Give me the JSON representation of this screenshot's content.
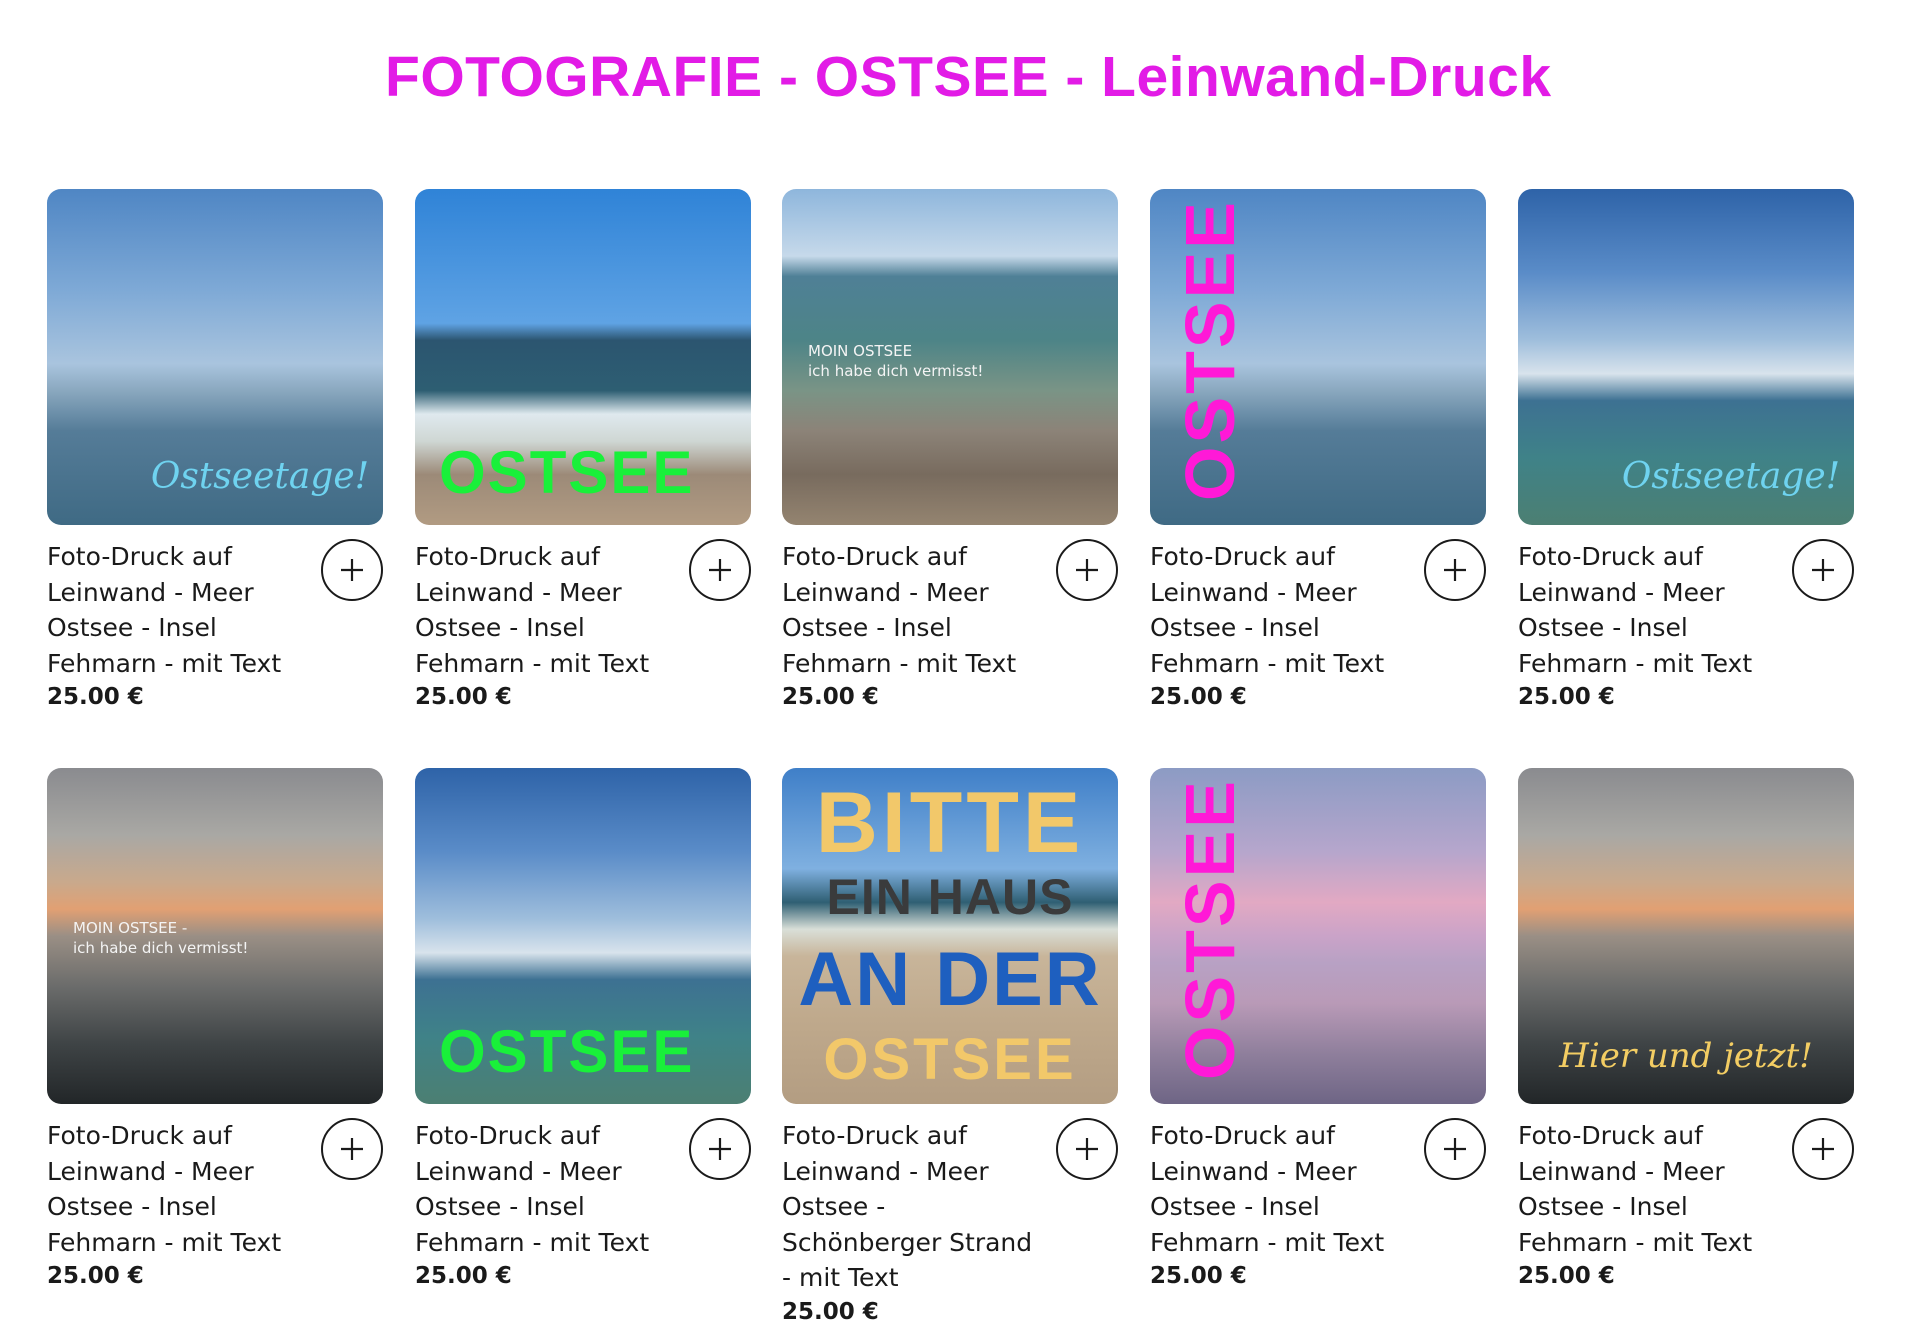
{
  "page": {
    "title": "FOTOGRAFIE - OSTSEE - Leinwand-Druck"
  },
  "colors": {
    "title": "#e21be6",
    "text": "#1a1a1a",
    "overlay_green": "#19f03a",
    "overlay_magenta": "#ff19d7",
    "overlay_cyan": "#6fd3f0",
    "overlay_yellow": "#f3cd63"
  },
  "add_button": {
    "icon": "plus-icon"
  },
  "products": [
    {
      "name": "Foto-Druck auf Leinwand - Meer Ostsee - Insel Fehmarn - mit Text",
      "price": "25.00 €",
      "image": "sea-horizon-blue-sky",
      "overlay_text": "Ostseetage!"
    },
    {
      "name": "Foto-Druck auf Leinwand - Meer Ostsee - Insel Fehmarn - mit Text",
      "price": "25.00 €",
      "image": "breaking-waves-beach",
      "overlay_text": "OSTSEE"
    },
    {
      "name": "Foto-Druck auf Leinwand - Meer Ostsee - Insel Fehmarn - mit Text",
      "price": "25.00 €",
      "image": "pebble-beach-clear-water",
      "overlay_lines": [
        "MOIN OSTSEE",
        "ich habe dich vermisst!"
      ]
    },
    {
      "name": "Foto-Druck auf Leinwand - Meer Ostsee - Insel Fehmarn - mit Text",
      "price": "25.00 €",
      "image": "sea-horizon-blue-sky",
      "overlay_text": "OSTSEE"
    },
    {
      "name": "Foto-Druck auf Leinwand - Meer Ostsee - Insel Fehmarn - mit Text",
      "price": "25.00 €",
      "image": "cloudy-sky-sea",
      "overlay_text": "Ostseetage!"
    },
    {
      "name": "Foto-Druck auf Leinwand - Meer Ostsee - Insel Fehmarn - mit Text",
      "price": "25.00 €",
      "image": "sunset-sea",
      "overlay_lines": [
        "MOIN OSTSEE -",
        "ich habe dich vermisst!"
      ]
    },
    {
      "name": "Foto-Druck auf Leinwand - Meer Ostsee - Insel Fehmarn - mit Text",
      "price": "25.00 €",
      "image": "cloudy-sky-sea",
      "overlay_text": "OSTSEE"
    },
    {
      "name": "Foto-Druck auf Leinwand - Meer Ostsee - Schönberger Strand - mit Text",
      "price": "25.00 €",
      "image": "sand-beach-sea",
      "overlay_lines": [
        "BITTE",
        "EIN HAUS",
        "AN DER",
        "OSTSEE"
      ]
    },
    {
      "name": "Foto-Druck auf Leinwand - Meer Ostsee - Insel Fehmarn - mit Text",
      "price": "25.00 €",
      "image": "pink-sunset-sea",
      "overlay_text": "OSTSEE"
    },
    {
      "name": "Foto-Druck auf Leinwand - Meer Ostsee - Insel Fehmarn - mit Text",
      "price": "25.00 €",
      "image": "sunset-sea",
      "overlay_text": "Hier und jetzt!"
    }
  ]
}
